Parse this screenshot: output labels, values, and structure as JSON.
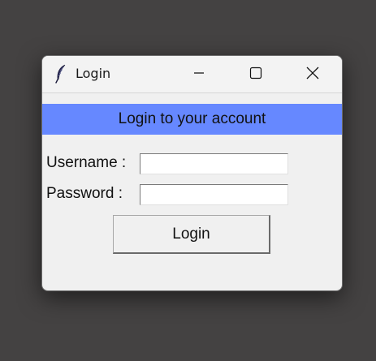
{
  "window": {
    "title": "Login",
    "app_icon": "feather-icon",
    "controls": {
      "minimize": "minimize-icon",
      "maximize": "maximize-icon",
      "close": "close-icon"
    }
  },
  "form": {
    "heading": "Login to your account",
    "heading_color": "#6688ff",
    "username_label": "Username :",
    "username_value": "",
    "password_label": "Password :",
    "password_value": "",
    "login_button": "Login"
  }
}
